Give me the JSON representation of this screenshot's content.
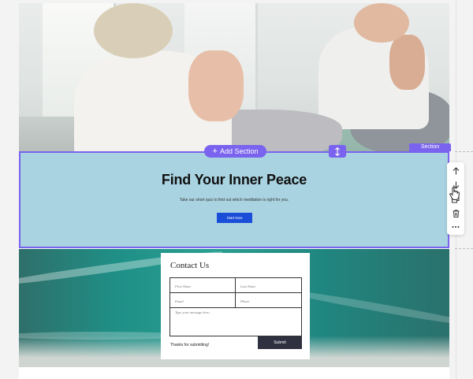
{
  "editor": {
    "add_section_label": "Add Section",
    "section_tag": "Section",
    "accent_color": "#7a63ee",
    "toolbar_icons": [
      "arrow-up-icon",
      "arrow-down-icon",
      "duplicate-icon",
      "trash-icon",
      "more-icon"
    ]
  },
  "hero": {
    "image": "two people meditating in a bright room"
  },
  "section": {
    "title": "Find Your Inner Peace",
    "subtitle": "Take our short quiz to find out which meditation is right for you.",
    "button_label": "Start Now",
    "background": "#a9d3e1"
  },
  "contact": {
    "title": "Contact Us",
    "fields": {
      "first_name_placeholder": "First Name",
      "last_name_placeholder": "Last Name",
      "email_placeholder": "Email",
      "phone_placeholder": "Phone",
      "message_placeholder": "Type your message here..."
    },
    "thanks_text": "Thanks for submitting!",
    "submit_label": "Submit"
  }
}
